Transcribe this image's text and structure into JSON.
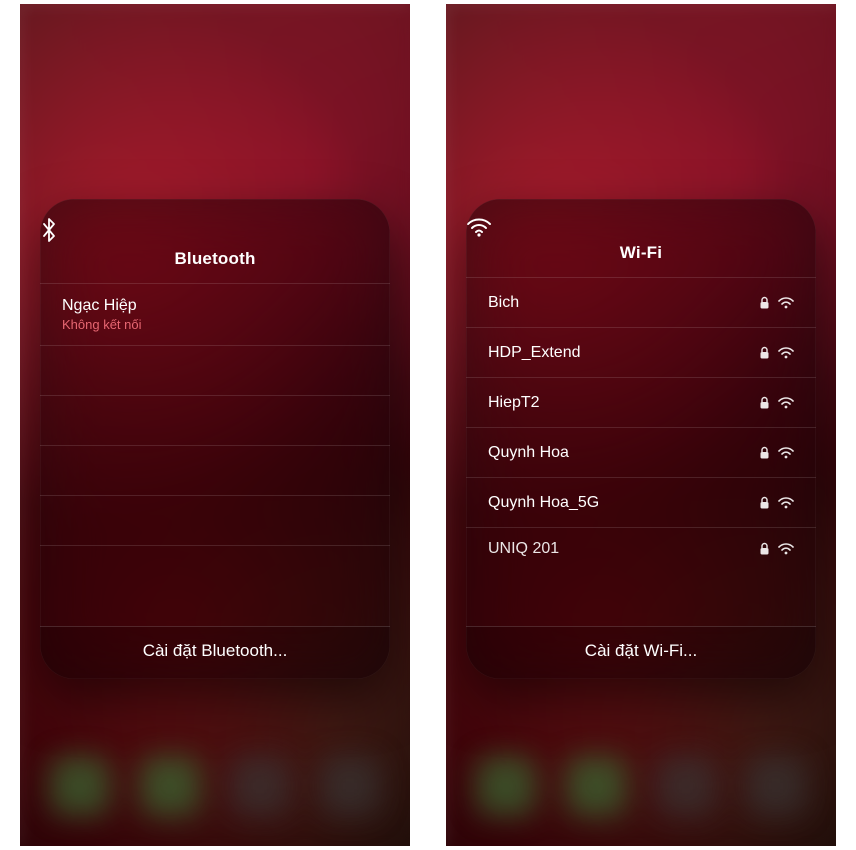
{
  "bluetooth": {
    "title": "Bluetooth",
    "footer": "Cài đặt Bluetooth...",
    "devices": [
      {
        "name": "Ngạc Hiệp",
        "status": "Không kết nối"
      }
    ]
  },
  "wifi": {
    "title": "Wi-Fi",
    "footer": "Cài đặt Wi-Fi...",
    "networks": [
      {
        "name": "Bich",
        "locked": true
      },
      {
        "name": "HDP_Extend",
        "locked": true
      },
      {
        "name": "HiepT2",
        "locked": true
      },
      {
        "name": "Quynh Hoa",
        "locked": true
      },
      {
        "name": "Quynh Hoa_5G",
        "locked": true
      },
      {
        "name": "UNIQ 201",
        "locked": true
      }
    ]
  }
}
